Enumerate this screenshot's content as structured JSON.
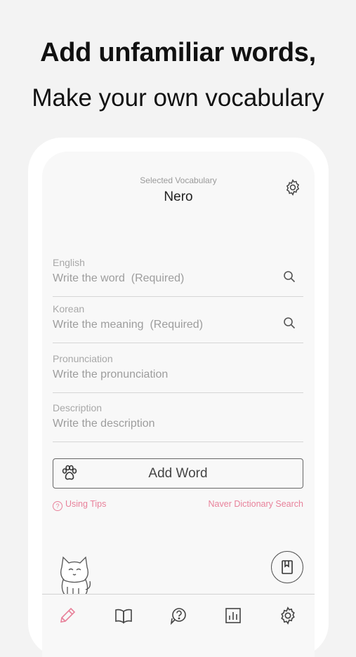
{
  "promo": {
    "headline": "Add unfamiliar words,",
    "subline": "Make your own vocabulary"
  },
  "header": {
    "caption": "Selected Vocabulary",
    "vocabulary_name": "Nero",
    "settings_icon": "gear-icon"
  },
  "form": {
    "fields": [
      {
        "label": "English",
        "placeholder": "Write the word  (Required)",
        "icon": "search-icon"
      },
      {
        "label": "Korean",
        "placeholder": "Write the meaning  (Required)",
        "icon": "search-icon"
      },
      {
        "label": "Pronunciation",
        "placeholder": "Write the pronunciation"
      },
      {
        "label": "Description",
        "placeholder": "Write the description"
      }
    ],
    "add_button_label": "Add Word",
    "add_button_icon": "paw-icon"
  },
  "links": {
    "tips": "Using Tips",
    "naver": "Naver Dictionary Search"
  },
  "tabs": [
    {
      "name": "add",
      "icon": "pen-icon",
      "active": true
    },
    {
      "name": "vocabulary",
      "icon": "book-icon",
      "active": false
    },
    {
      "name": "quiz",
      "icon": "question-chat-icon",
      "active": false
    },
    {
      "name": "statistics",
      "icon": "chart-icon",
      "active": false
    },
    {
      "name": "settings",
      "icon": "gear-icon",
      "active": false
    }
  ],
  "colors": {
    "accent": "#e8819a",
    "background": "#f3f3f3",
    "screen": "#f8f8f8"
  }
}
